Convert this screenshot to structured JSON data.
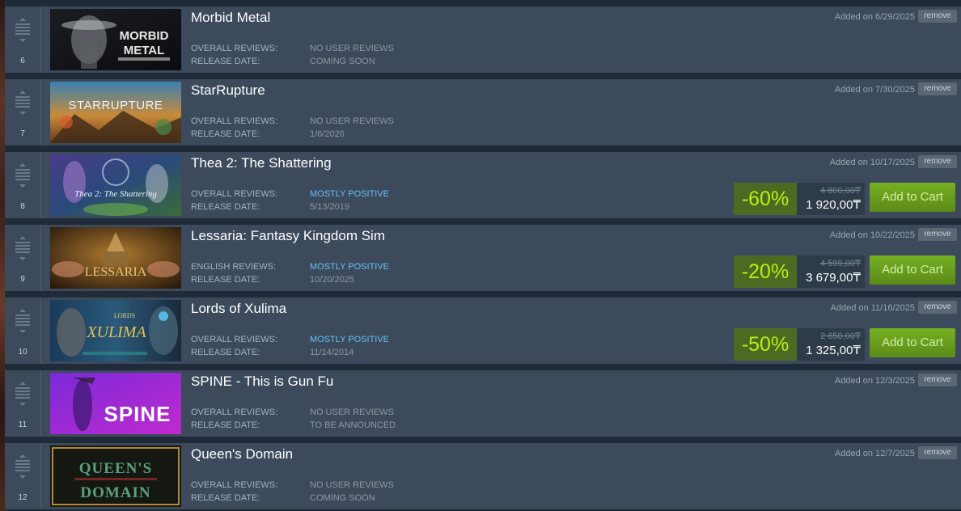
{
  "wishlist": {
    "items": [
      {
        "rank": "6",
        "title": "Morbid Metal",
        "reviews_label": "OVERALL REVIEWS:",
        "reviews_value": "NO USER REVIEWS",
        "reviews_positive": false,
        "release_label": "RELEASE DATE:",
        "release_value": "COMING SOON",
        "added": "Added on 6/29/2025",
        "remove_label": "remove",
        "capsule_text": "MORBID\nMETAL"
      },
      {
        "rank": "7",
        "title": "StarRupture",
        "reviews_label": "OVERALL REVIEWS:",
        "reviews_value": "NO USER REVIEWS",
        "reviews_positive": false,
        "release_label": "RELEASE DATE:",
        "release_value": "1/6/2026",
        "added": "Added on 7/30/2025",
        "remove_label": "remove",
        "capsule_text": "STARRUPTURE"
      },
      {
        "rank": "8",
        "title": "Thea 2: The Shattering",
        "reviews_label": "OVERALL REVIEWS:",
        "reviews_value": "MOSTLY POSITIVE",
        "reviews_positive": true,
        "release_label": "RELEASE DATE:",
        "release_value": "5/13/2019",
        "added": "Added on 10/17/2025",
        "remove_label": "remove",
        "discount": "-60%",
        "original_price": "4 800,00₸",
        "final_price": "1 920,00₸",
        "cart_label": "Add to Cart",
        "capsule_text": "Thea 2: The Shattering"
      },
      {
        "rank": "9",
        "title": "Lessaria: Fantasy Kingdom Sim",
        "reviews_label": "ENGLISH REVIEWS:",
        "reviews_value": "MOSTLY POSITIVE",
        "reviews_positive": true,
        "release_label": "RELEASE DATE:",
        "release_value": "10/20/2025",
        "added": "Added on 10/22/2025",
        "remove_label": "remove",
        "discount": "-20%",
        "original_price": "4 599,00₸",
        "final_price": "3 679,00₸",
        "cart_label": "Add to Cart",
        "capsule_text": "LESSARIA"
      },
      {
        "rank": "10",
        "title": "Lords of Xulima",
        "reviews_label": "OVERALL REVIEWS:",
        "reviews_value": "MOSTLY POSITIVE",
        "reviews_positive": true,
        "release_label": "RELEASE DATE:",
        "release_value": "11/14/2014",
        "added": "Added on 11/16/2025",
        "remove_label": "remove",
        "discount": "-50%",
        "original_price": "2 650,00₸",
        "final_price": "1 325,00₸",
        "cart_label": "Add to Cart",
        "capsule_text": "LORDS\nXULIMA"
      },
      {
        "rank": "11",
        "title": "SPINE - This is Gun Fu",
        "reviews_label": "OVERALL REVIEWS:",
        "reviews_value": "NO USER REVIEWS",
        "reviews_positive": false,
        "release_label": "RELEASE DATE:",
        "release_value": "TO BE ANNOUNCED",
        "added": "Added on 12/3/2025",
        "remove_label": "remove",
        "capsule_text": "SPINE"
      },
      {
        "rank": "12",
        "title": "Queen's Domain",
        "reviews_label": "OVERALL REVIEWS:",
        "reviews_value": "NO USER REVIEWS",
        "reviews_positive": false,
        "release_label": "RELEASE DATE:",
        "release_value": "COMING SOON",
        "added": "Added on 12/7/2025",
        "remove_label": "remove",
        "capsule_text": "QUEEN'S\nDOMAIN"
      }
    ]
  },
  "colors": {
    "page_bg": "#1b2838",
    "row_bg": "#3c4a5c",
    "positive": "#66c0f4",
    "discount_bg": "#4c6b22",
    "discount_text": "#beee11",
    "cart_green": "#75b022"
  },
  "icons": {
    "drag_handle": "drag-handle-icon"
  }
}
